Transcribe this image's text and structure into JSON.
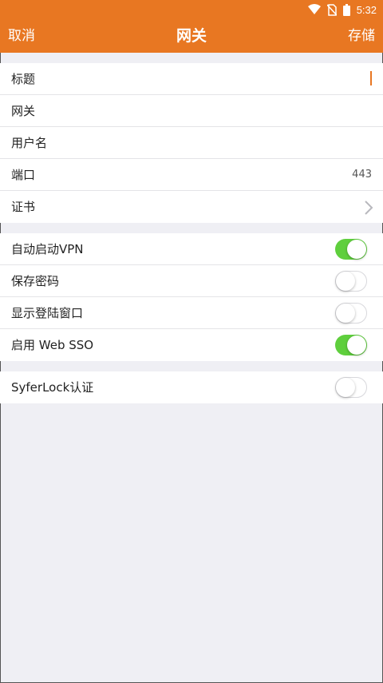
{
  "status_bar": {
    "time": "5:32",
    "icons": [
      "wifi-icon",
      "no-sim-icon",
      "battery-icon"
    ]
  },
  "nav": {
    "cancel_label": "取消",
    "title": "网关",
    "save_label": "存储"
  },
  "gateway_fields": {
    "title_label": "标题",
    "gateway_label": "网关",
    "username_label": "用户名",
    "port_label": "端口",
    "port_value": "443",
    "certificate_label": "证书"
  },
  "toggles": {
    "auto_vpn": {
      "label": "自动启动VPN",
      "on": true
    },
    "save_password": {
      "label": "保存密码",
      "on": false
    },
    "show_login": {
      "label": "显示登陆窗口",
      "on": false
    },
    "web_sso": {
      "label": "启用 Web SSO",
      "on": true
    },
    "syferlock": {
      "label": "SyferLock认证",
      "on": false
    }
  },
  "colors": {
    "accent": "#e87722",
    "toggle_on": "#5fcf3d",
    "background": "#efeff4"
  }
}
